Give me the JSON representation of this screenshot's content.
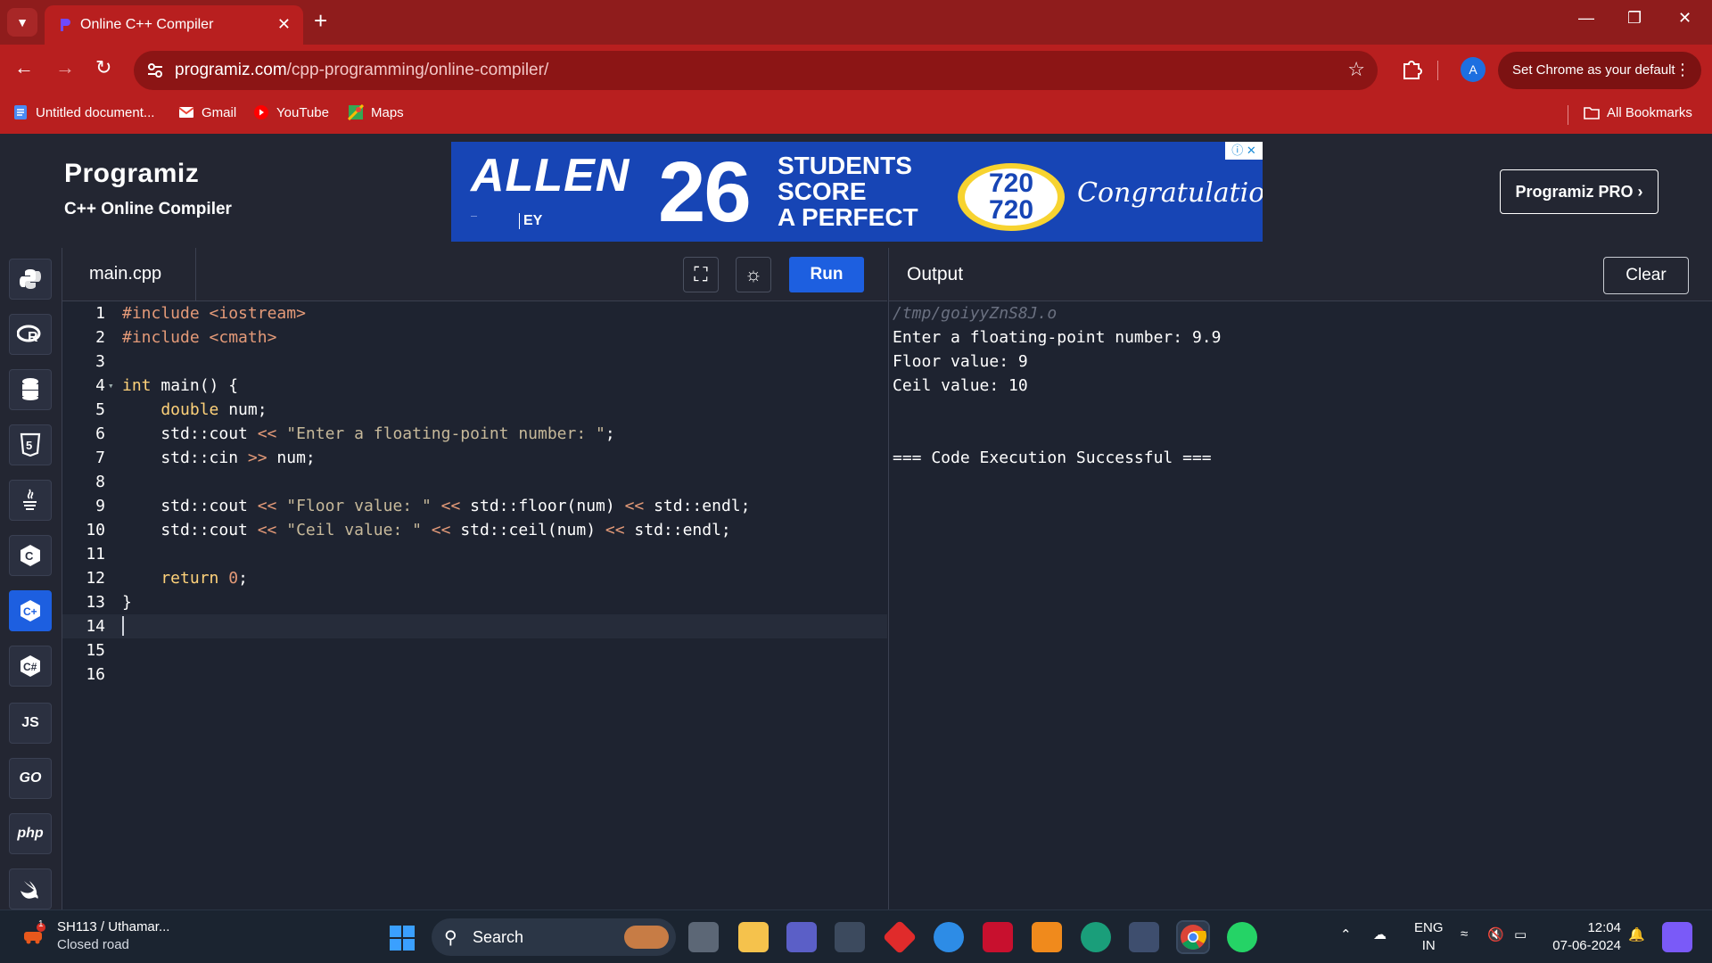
{
  "browser": {
    "tab_title": "Online C++ Compiler",
    "url_host": "programiz.com",
    "url_path": "/cpp-programming/online-compiler/",
    "default_button": "Set Chrome as your default",
    "profile_initial": "A",
    "bookmarks": [
      "Untitled document...",
      "Gmail",
      "YouTube",
      "Maps"
    ],
    "all_bookmarks": "All Bookmarks"
  },
  "header": {
    "brand": "Programiz",
    "subtitle": "C++ Online Compiler",
    "pro_button": "Programiz PRO ›",
    "ad": {
      "brand": "ALLEN",
      "number": "26",
      "line1": "STUDENTS",
      "line2": "SCORE",
      "line3": "A PERFECT",
      "score_top": "720",
      "score_bottom": "720",
      "congrats": "Congratulations",
      "partner": "EY"
    }
  },
  "sidebar": {
    "languages": [
      "python",
      "r",
      "sql",
      "html",
      "java",
      "c",
      "cpp",
      "csharp",
      "JS",
      "GO",
      "php",
      "swift"
    ],
    "active": "cpp"
  },
  "editor": {
    "file_name": "main.cpp",
    "run_label": "Run",
    "line_numbers": [
      "1",
      "2",
      "3",
      "4",
      "5",
      "6",
      "7",
      "8",
      "9",
      "10",
      "11",
      "12",
      "13",
      "14",
      "15",
      "16"
    ]
  },
  "code": {
    "l1a": "#include ",
    "l1b": "<iostream>",
    "l2a": "#include ",
    "l2b": "<cmath>",
    "l4a": "int",
    "l4b": " main() {",
    "l5a": "    double",
    "l5b": " num;",
    "l6a": "    std::cout ",
    "l6op": "<<",
    "l6s": " \"Enter a floating-point number: \"",
    "l6e": ";",
    "l7a": "    std::cin ",
    "l7op": ">>",
    "l7b": " num;",
    "l9a": "    std::cout ",
    "l9op1": "<<",
    "l9s": " \"Floor value: \" ",
    "l9op2": "<<",
    "l9b": " std::floor(num) ",
    "l9op3": "<<",
    "l9c": " std::endl;",
    "l10a": "    std::cout ",
    "l10op1": "<<",
    "l10s": " \"Ceil value: \" ",
    "l10op2": "<<",
    "l10b": " std::ceil(num) ",
    "l10op3": "<<",
    "l10c": " std::endl;",
    "l12a": "    return",
    "l12n": " 0",
    "l12e": ";",
    "l13": "}"
  },
  "output": {
    "label": "Output",
    "clear_label": "Clear",
    "lines": [
      "/tmp/goiyyZnS8J.o",
      "Enter a floating-point number: 9.9",
      "Floor value: 9",
      "Ceil value: 10",
      "",
      "",
      "=== Code Execution Successful ==="
    ]
  },
  "taskbar": {
    "weather_title": "SH113 / Uthamar...",
    "weather_sub": "Closed road",
    "weather_badge": "1",
    "search_placeholder": "Search",
    "lang_top": "ENG",
    "lang_bottom": "IN",
    "time": "12:04",
    "date": "07-06-2024"
  },
  "colors": {
    "chrome_frame": "#8f1c1c",
    "chrome_toolbar": "#b81f1f",
    "page_bg": "#1e2330",
    "accent": "#1d5fe0"
  }
}
